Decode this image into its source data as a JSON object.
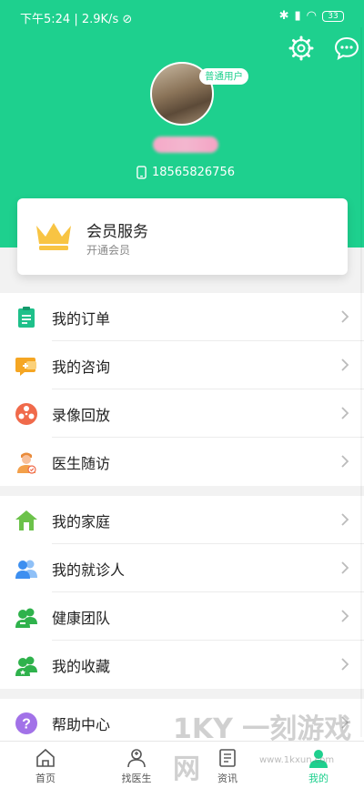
{
  "status_bar": {
    "time": "下午5:24",
    "speed": "2.9K/s",
    "battery": "33"
  },
  "profile": {
    "badge": "普通用户",
    "phone": "18565826756"
  },
  "vip_card": {
    "title": "会员服务",
    "subtitle": "开通会员"
  },
  "menu_group_1": [
    {
      "label": "我的订单",
      "icon": "clipboard-icon",
      "color": "#1ec08a"
    },
    {
      "label": "我的咨询",
      "icon": "chat-plus-icon",
      "color": "#f5a623"
    },
    {
      "label": "录像回放",
      "icon": "film-reel-icon",
      "color": "#f06a4b"
    },
    {
      "label": "医生随访",
      "icon": "doctor-icon",
      "color": "#f3a04a"
    }
  ],
  "menu_group_2": [
    {
      "label": "我的家庭",
      "icon": "house-icon",
      "color": "#6cc24a"
    },
    {
      "label": "我的就诊人",
      "icon": "people-icon",
      "color": "#3d8ff0"
    },
    {
      "label": "健康团队",
      "icon": "team-icon",
      "color": "#2fb24c"
    },
    {
      "label": "我的收藏",
      "icon": "collect-icon",
      "color": "#2fb24c"
    }
  ],
  "menu_group_3": [
    {
      "label": "帮助中心",
      "icon": "help-icon",
      "color": "#a272e8"
    }
  ],
  "tabbar": [
    {
      "label": "首页",
      "icon": "home-icon"
    },
    {
      "label": "找医生",
      "icon": "doctor-find-icon"
    },
    {
      "label": "资讯",
      "icon": "news-icon"
    },
    {
      "label": "我的",
      "icon": "profile-icon"
    }
  ],
  "watermark": {
    "text": "1KY 一刻游戏网",
    "url": "www.1kxun.com"
  }
}
